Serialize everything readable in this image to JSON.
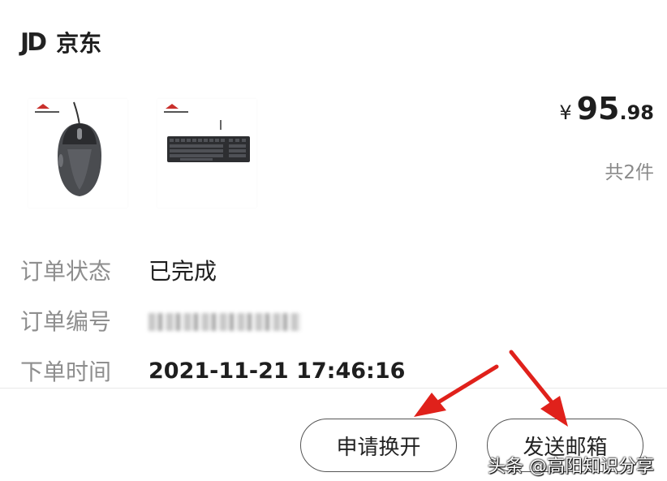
{
  "store": {
    "logo": "JD",
    "name": "京东"
  },
  "products": [
    {
      "name": "mouse",
      "icon": "mouse-image"
    },
    {
      "name": "keyboard",
      "icon": "keyboard-image"
    }
  ],
  "price": {
    "symbol": "¥",
    "integer": "95",
    "decimal": ".98"
  },
  "item_count": "共2件",
  "order": {
    "status_label": "订单状态",
    "status_value": "已完成",
    "number_label": "订单编号",
    "time_label": "下单时间",
    "time_value": "2021-11-21 17:46:16"
  },
  "actions": {
    "exchange_label": "申请换开",
    "email_label": "发送邮箱"
  },
  "watermark": "头条 @高阳知识分享",
  "colors": {
    "annotation_arrow": "#e0211b"
  }
}
